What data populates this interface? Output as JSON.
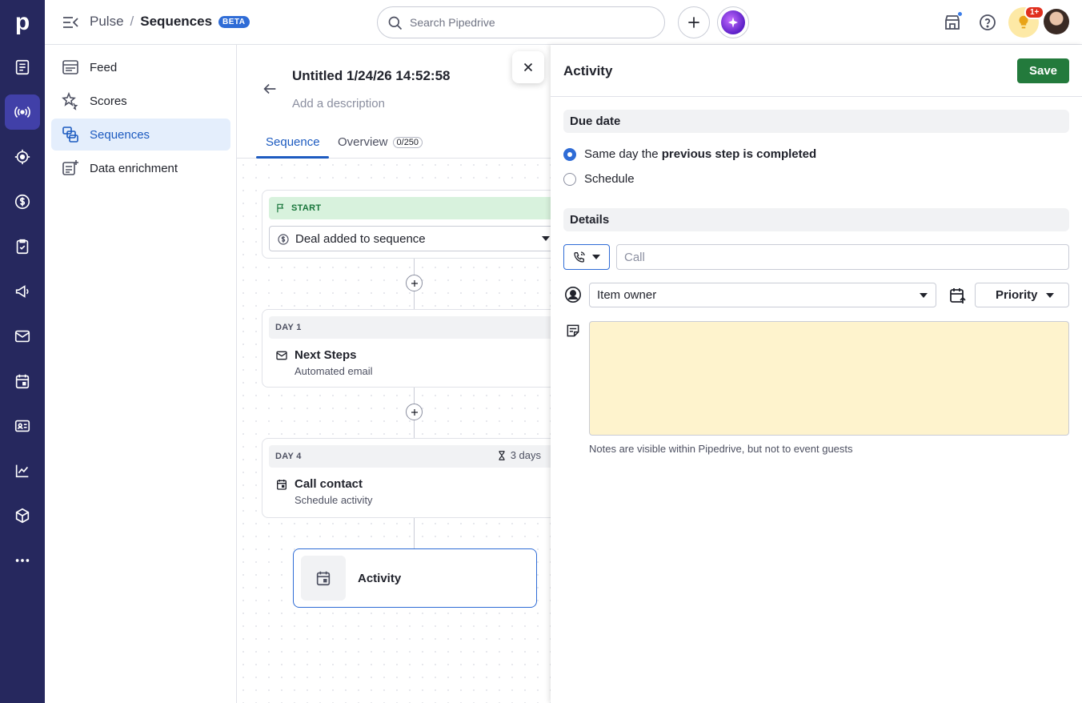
{
  "app": {
    "logo_letter": "p",
    "breadcrumb_parent": "Pulse",
    "breadcrumb_separator": "/",
    "breadcrumb_current": "Sequences",
    "beta_badge": "BETA",
    "search_placeholder": "Search Pipedrive",
    "tips_badge": "1+"
  },
  "rail": {
    "items": [
      "leads-icon",
      "pulse-icon",
      "target-icon",
      "deals-icon",
      "activities-icon",
      "campaigns-icon",
      "mail-icon",
      "calendar-icon",
      "contacts-icon",
      "insights-icon",
      "products-icon",
      "more-icon"
    ],
    "active": "pulse-icon"
  },
  "sidenav": {
    "items": [
      {
        "label": "Feed",
        "icon": "feed-icon"
      },
      {
        "label": "Scores",
        "icon": "scores-icon"
      },
      {
        "label": "Sequences",
        "icon": "sequences-icon",
        "active": true
      },
      {
        "label": "Data enrichment",
        "icon": "data-enrichment-icon"
      }
    ]
  },
  "sequence": {
    "title": "Untitled 1/24/26 14:52:58",
    "description_placeholder": "Add a description",
    "tabs": [
      {
        "label": "Sequence",
        "active": true
      },
      {
        "label": "Overview",
        "counter": "0/250"
      }
    ],
    "start": {
      "band_label": "START",
      "trigger": "Deal added to sequence"
    },
    "steps": [
      {
        "day": "DAY 1",
        "name": "Next Steps",
        "type": "Automated email",
        "icon": "mail-icon"
      },
      {
        "day": "DAY 4",
        "wait": "3 days",
        "name": "Call contact",
        "type": "Schedule activity",
        "icon": "calendar-icon"
      }
    ],
    "new_step": {
      "label": "Activity",
      "icon": "calendar-icon"
    }
  },
  "panel": {
    "title": "Activity",
    "save_label": "Save",
    "due_date": {
      "section": "Due date",
      "option_1_prefix": "Same day the ",
      "option_1_bold": "previous step is completed",
      "option_2": "Schedule",
      "selected": 1
    },
    "details": {
      "section": "Details",
      "activity_type_icon": "phone-icon",
      "subject_placeholder": "Call",
      "owner": "Item owner",
      "priority_label": "Priority",
      "note_hint": "Notes are visible within Pipedrive, but not to event guests"
    }
  },
  "colors": {
    "rail_bg": "#26285e",
    "accent_blue": "#2f6cd6",
    "save_green": "#237a3c",
    "note_bg": "#fef3cd"
  }
}
